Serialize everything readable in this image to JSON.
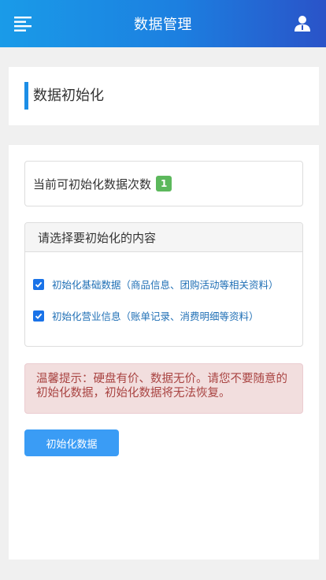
{
  "header": {
    "title": "数据管理",
    "menu_icon": "menu-icon",
    "user_icon": "user-icon"
  },
  "section": {
    "title": "数据初始化"
  },
  "count": {
    "label": "当前可初始化数据次数",
    "value": "1"
  },
  "select_panel": {
    "heading": "请选择要初始化的内容",
    "options": [
      {
        "label": "初始化基础数据（商品信息、团购活动等相关资料）",
        "checked": true
      },
      {
        "label": "初始化营业信息（账单记录、消费明细等资料）",
        "checked": true
      }
    ]
  },
  "warning": {
    "text": "温馨提示：硬盘有价、数据无价。请您不要随意的初始化数据，初始化数据将无法恢复。"
  },
  "actions": {
    "init_label": "初始化数据"
  },
  "colors": {
    "header_start": "#1a9be8",
    "header_end": "#2a53c8",
    "accent": "#1c8ee6",
    "badge": "#5cb85c",
    "warning_bg": "#f2dede",
    "warning_text": "#a94442",
    "button": "#3a9cf5"
  }
}
